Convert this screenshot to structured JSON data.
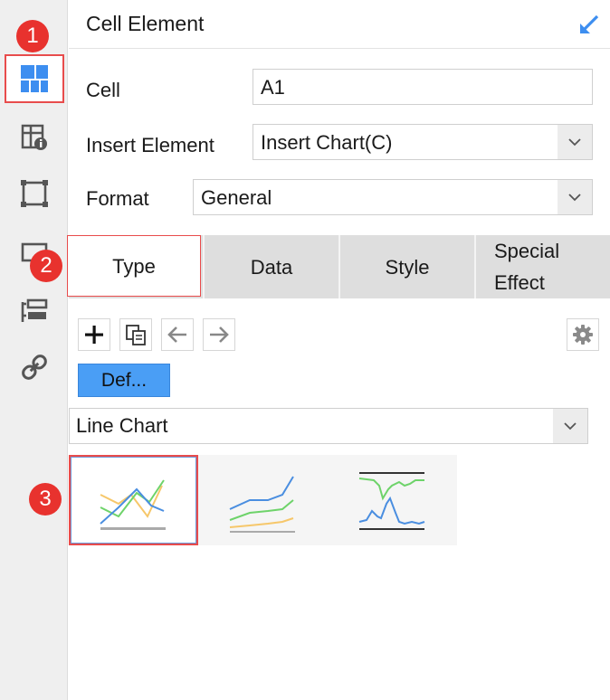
{
  "panel": {
    "title": "Cell Element",
    "collapse_icon": "arrow-down-left-icon"
  },
  "sidebar": {
    "items": [
      {
        "name": "cell-element-icon",
        "active": true
      },
      {
        "name": "cell-attribute-icon",
        "active": false
      },
      {
        "name": "float-element-icon",
        "active": false
      },
      {
        "name": "widget-icon",
        "active": false
      },
      {
        "name": "form-layout-icon",
        "active": false
      },
      {
        "name": "hyperlink-icon",
        "active": false
      }
    ]
  },
  "badges": [
    "1",
    "2",
    "3"
  ],
  "form": {
    "cell_label": "Cell",
    "cell_value": "A1",
    "insert_label": "Insert Element",
    "insert_value": "Insert Chart(C)",
    "format_label": "Format",
    "format_value": "General"
  },
  "tabs": [
    {
      "label": "Type",
      "active": true
    },
    {
      "label": "Data",
      "active": false
    },
    {
      "label": "Style",
      "active": false
    },
    {
      "label": "Special Effect",
      "active": false
    }
  ],
  "toolbar": {
    "add_icon": "plus-icon",
    "copy_icon": "copy-icon",
    "left_icon": "arrow-left-icon",
    "right_icon": "arrow-right-icon",
    "settings_icon": "gear-icon"
  },
  "chart": {
    "default_button": "Def...",
    "type_value": "Line Chart",
    "thumbnails": [
      {
        "name": "line-chart-thumbnail",
        "selected": true
      },
      {
        "name": "stacked-line-chart-thumbnail",
        "selected": false
      },
      {
        "name": "line-chart-with-bounds-thumbnail",
        "selected": false
      }
    ]
  },
  "colors": {
    "accent": "#4a9ef5",
    "highlight": "#e84c4c",
    "badge": "#e8322e",
    "series_blue": "#4a8ee0",
    "series_green": "#6ed36a",
    "series_orange": "#f6c76a"
  }
}
